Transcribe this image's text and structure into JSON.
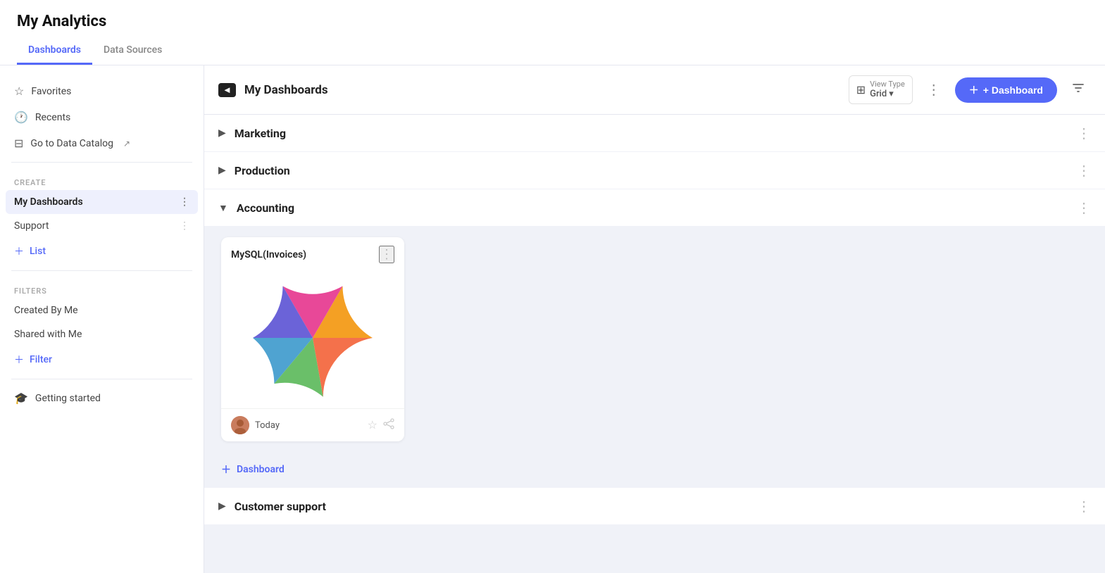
{
  "app": {
    "title": "My Analytics"
  },
  "tabs": [
    {
      "id": "dashboards",
      "label": "Dashboards",
      "active": true
    },
    {
      "id": "data-sources",
      "label": "Data Sources",
      "active": false
    }
  ],
  "sidebar": {
    "nav_items": [
      {
        "id": "favorites",
        "label": "Favorites",
        "icon": "★"
      },
      {
        "id": "recents",
        "label": "Recents",
        "icon": "⏱"
      },
      {
        "id": "data-catalog",
        "label": "Go to Data Catalog",
        "icon": "⊟"
      }
    ],
    "create_section_label": "CREATE",
    "create_items": [
      {
        "id": "my-dashboards",
        "label": "My Dashboards",
        "active": true
      },
      {
        "id": "support",
        "label": "Support",
        "active": false
      }
    ],
    "add_list_label": "+ List",
    "filters_section_label": "FILTERS",
    "filter_items": [
      {
        "id": "created-by-me",
        "label": "Created By Me"
      },
      {
        "id": "shared-with-me",
        "label": "Shared with Me"
      }
    ],
    "add_filter_label": "+ Filter",
    "getting_started_label": "Getting started"
  },
  "main": {
    "header": {
      "icon_text": "◄",
      "title": "My Dashboards",
      "view_type_label": "View Type",
      "view_type_value": "Grid",
      "add_dashboard_label": "+ Dashboard"
    },
    "sections": [
      {
        "id": "marketing",
        "label": "Marketing",
        "expanded": false
      },
      {
        "id": "production",
        "label": "Production",
        "expanded": false
      },
      {
        "id": "accounting",
        "label": "Accounting",
        "expanded": true
      },
      {
        "id": "customer-support",
        "label": "Customer support",
        "expanded": false
      }
    ],
    "accounting_cards": [
      {
        "id": "mysql-invoices",
        "title": "MySQL(Invoices)",
        "user_date": "Today",
        "pie_segments": [
          {
            "color": "#f4a024",
            "start": 0,
            "end": 60
          },
          {
            "color": "#e84898",
            "start": 60,
            "end": 120
          },
          {
            "color": "#6b63d8",
            "start": 120,
            "end": 180
          },
          {
            "color": "#4fa3d1",
            "start": 180,
            "end": 230
          },
          {
            "color": "#6abf69",
            "start": 230,
            "end": 280
          },
          {
            "color": "#f4714b",
            "start": 280,
            "end": 360
          }
        ]
      }
    ],
    "add_dashboard_inline_label": "+ Dashboard"
  },
  "colors": {
    "accent": "#5569f8",
    "active_tab_border": "#5569f8"
  }
}
